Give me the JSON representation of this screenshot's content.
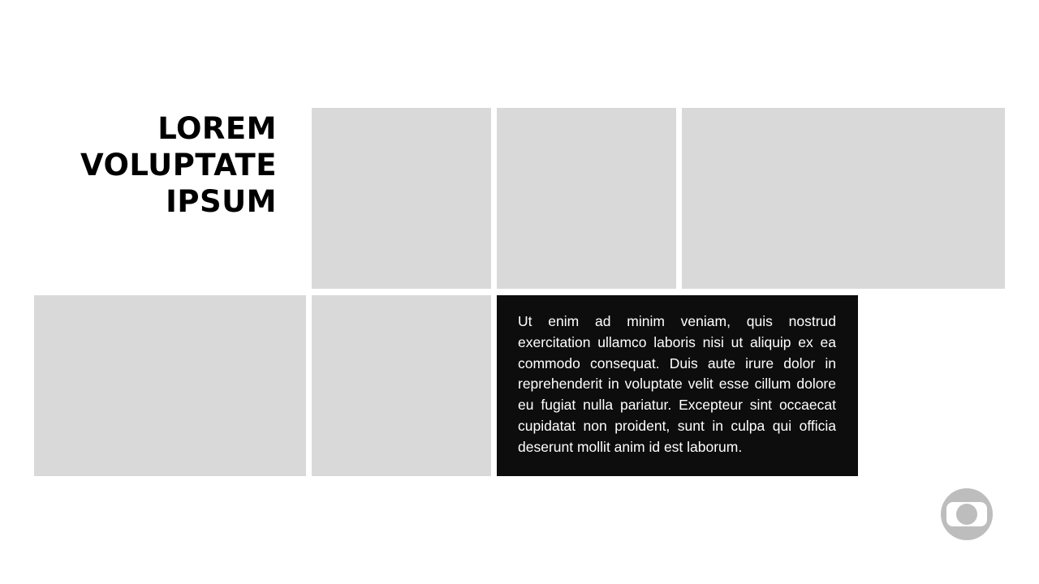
{
  "slide": {
    "title_lines": [
      "LOREM",
      "VOLUPTATE",
      "IPSUM"
    ],
    "body_text": "Ut enim ad minim veniam, quis nostrud exercitation ullamco laboris nisi ut aliquip ex ea commodo consequat. Duis aute irure dolor in reprehenderit in voluptate velit esse cillum dolore eu fugiat nulla pariatur. Excepteur sint occaecat cupidatat non proident, sunt in culpa qui officia deserunt mollit anim id est laborum.",
    "logo_icon": "globo-logo-icon"
  },
  "colors": {
    "background": "#ffffff",
    "placeholder": "#d9d9d9",
    "text_box": "#0d0d0d",
    "logo": "#bdbdbd"
  }
}
